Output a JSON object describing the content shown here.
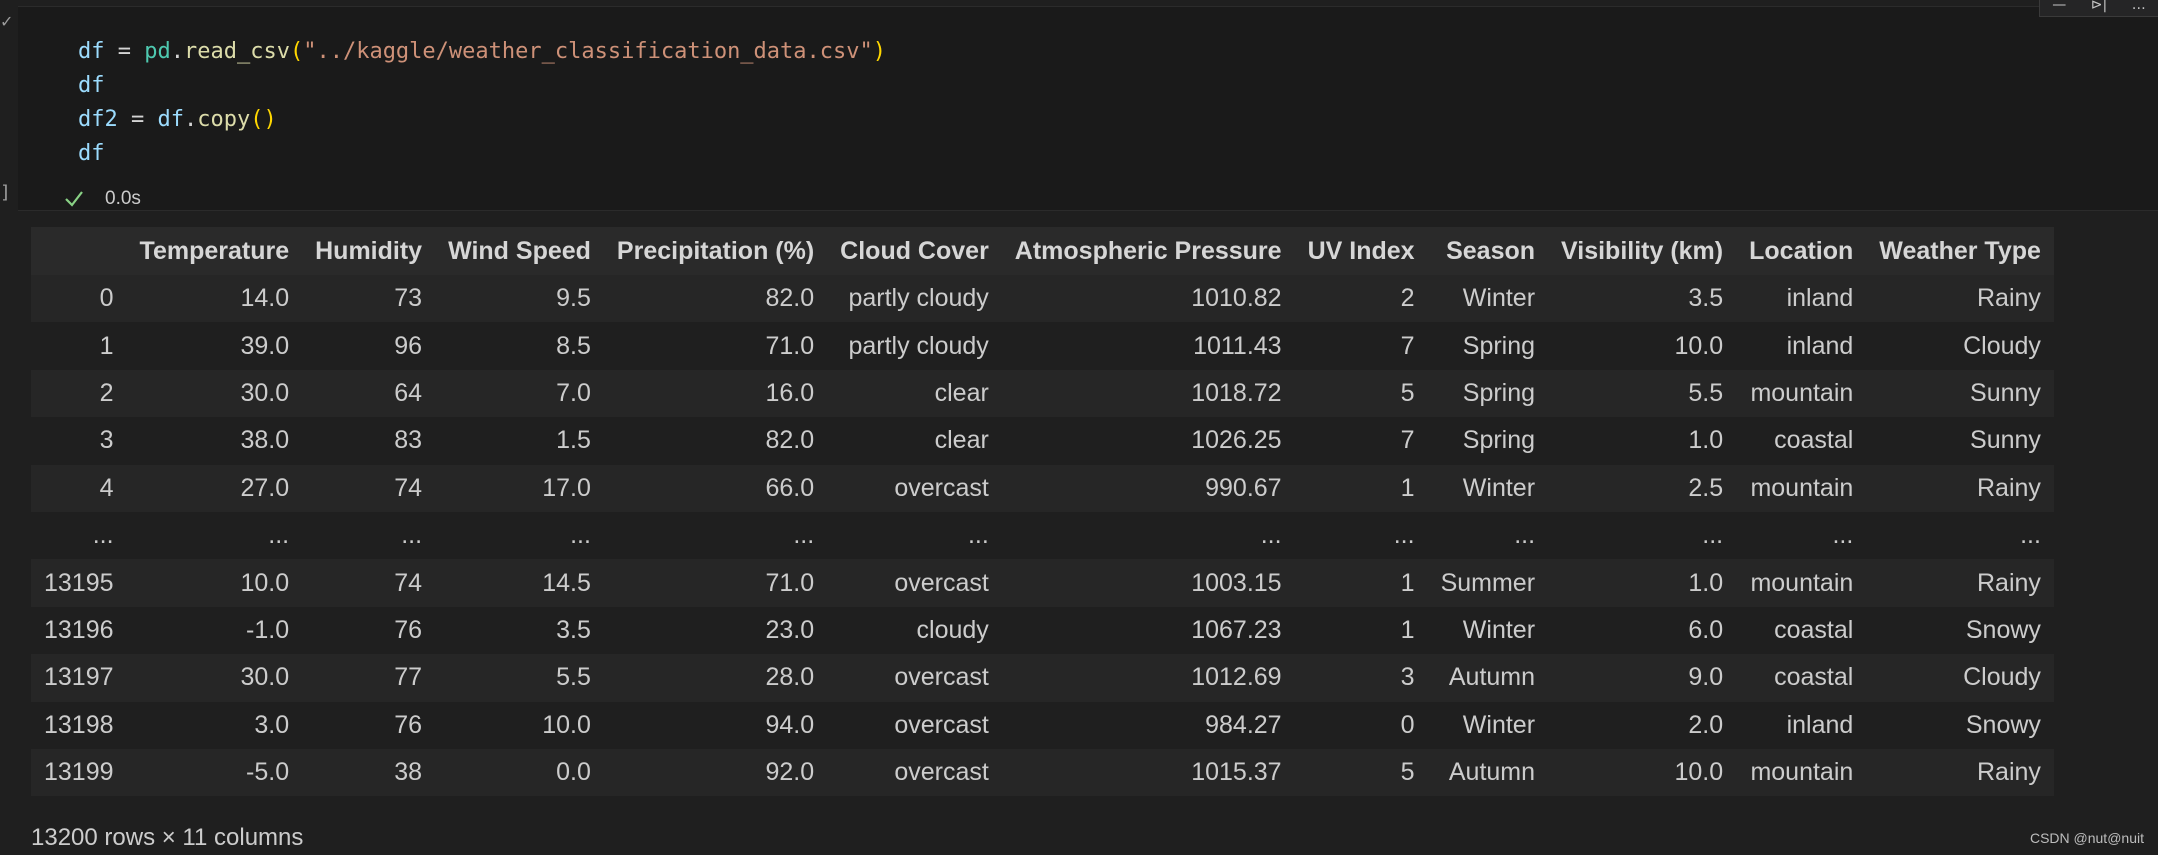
{
  "cell": {
    "code_lines": [
      [
        {
          "t": "df",
          "c": "var"
        },
        {
          "t": " = ",
          "c": "op"
        },
        {
          "t": "pd",
          "c": "mod"
        },
        {
          "t": ".",
          "c": "op"
        },
        {
          "t": "read_csv",
          "c": "fn"
        },
        {
          "t": "(",
          "c": "paren"
        },
        {
          "t": "\"../kaggle/weather_classification_data.csv\"",
          "c": "str"
        },
        {
          "t": ")",
          "c": "paren"
        }
      ],
      [
        {
          "t": "df",
          "c": "var"
        }
      ],
      [
        {
          "t": "df2",
          "c": "var"
        },
        {
          "t": " = ",
          "c": "op"
        },
        {
          "t": "df",
          "c": "var"
        },
        {
          "t": ".",
          "c": "op"
        },
        {
          "t": "copy",
          "c": "fn"
        },
        {
          "t": "()",
          "c": "paren"
        }
      ],
      [
        {
          "t": "df",
          "c": "var"
        }
      ]
    ],
    "exec_time": "0.0s",
    "status_icon": "check-icon",
    "status_color": "#89d185"
  },
  "table": {
    "columns": [
      "",
      "Temperature",
      "Humidity",
      "Wind Speed",
      "Precipitation (%)",
      "Cloud Cover",
      "Atmospheric Pressure",
      "UV Index",
      "Season",
      "Visibility (km)",
      "Location",
      "Weather Type"
    ],
    "rows": [
      [
        "0",
        "14.0",
        "73",
        "9.5",
        "82.0",
        "partly cloudy",
        "1010.82",
        "2",
        "Winter",
        "3.5",
        "inland",
        "Rainy"
      ],
      [
        "1",
        "39.0",
        "96",
        "8.5",
        "71.0",
        "partly cloudy",
        "1011.43",
        "7",
        "Spring",
        "10.0",
        "inland",
        "Cloudy"
      ],
      [
        "2",
        "30.0",
        "64",
        "7.0",
        "16.0",
        "clear",
        "1018.72",
        "5",
        "Spring",
        "5.5",
        "mountain",
        "Sunny"
      ],
      [
        "3",
        "38.0",
        "83",
        "1.5",
        "82.0",
        "clear",
        "1026.25",
        "7",
        "Spring",
        "1.0",
        "coastal",
        "Sunny"
      ],
      [
        "4",
        "27.0",
        "74",
        "17.0",
        "66.0",
        "overcast",
        "990.67",
        "1",
        "Winter",
        "2.5",
        "mountain",
        "Rainy"
      ],
      [
        "...",
        "...",
        "...",
        "...",
        "...",
        "...",
        "...",
        "...",
        "...",
        "...",
        "...",
        "..."
      ],
      [
        "13195",
        "10.0",
        "74",
        "14.5",
        "71.0",
        "overcast",
        "1003.15",
        "1",
        "Summer",
        "1.0",
        "mountain",
        "Rainy"
      ],
      [
        "13196",
        "-1.0",
        "76",
        "3.5",
        "23.0",
        "cloudy",
        "1067.23",
        "1",
        "Winter",
        "6.0",
        "coastal",
        "Snowy"
      ],
      [
        "13197",
        "30.0",
        "77",
        "5.5",
        "28.0",
        "overcast",
        "1012.69",
        "3",
        "Autumn",
        "9.0",
        "coastal",
        "Cloudy"
      ],
      [
        "13198",
        "3.0",
        "76",
        "10.0",
        "94.0",
        "overcast",
        "984.27",
        "0",
        "Winter",
        "2.0",
        "inland",
        "Snowy"
      ],
      [
        "13199",
        "-5.0",
        "38",
        "0.0",
        "92.0",
        "overcast",
        "1015.37",
        "5",
        "Autumn",
        "10.0",
        "mountain",
        "Rainy"
      ]
    ],
    "shape_note": "13200 rows × 11 columns"
  },
  "watermark": "CSDN @nut@nuit",
  "colors": {
    "background": "#1f1f1f",
    "cell_background": "#1a1a1a",
    "table_header": "#2a2a2a",
    "row_odd": "#262626",
    "row_even": "#1f1f1f"
  }
}
